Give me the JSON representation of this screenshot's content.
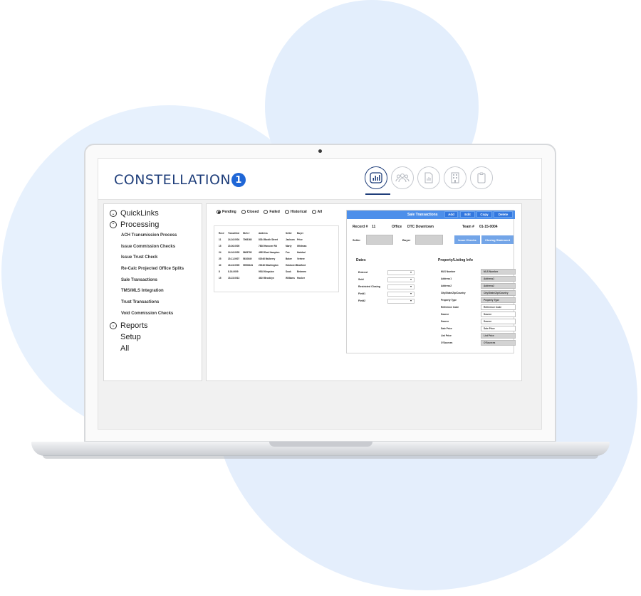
{
  "app": {
    "logo_text": "CONSTELLATION",
    "logo_badge": "1",
    "nav_icons": [
      "bar-chart-icon",
      "users-icon",
      "document-icon",
      "building-icon",
      "clipboard-icon"
    ],
    "active_nav": "bar-chart-icon",
    "accent_color": "#1f3e7a",
    "brand_blue": "#4d8fea"
  },
  "sidebar": {
    "sections": [
      {
        "label": "QuickLinks",
        "chevron": "down",
        "items": []
      },
      {
        "label": "Processing",
        "chevron": "up",
        "items": [
          "ACH Transmission Process",
          "Issue Commission Checks",
          "Issue Trust Check",
          "Re-Calc Projected Office Splits",
          "Sale Transactions",
          "TMS/MLS Integration",
          "Trust Transactions",
          "Void Commission Checks"
        ]
      },
      {
        "label": "Reports",
        "chevron": "down",
        "items": []
      },
      {
        "label": "Setup",
        "chevron": "",
        "items": []
      },
      {
        "label": "All",
        "chevron": "",
        "items": []
      }
    ]
  },
  "filters": {
    "options": [
      "Pending",
      "Closed",
      "Failed",
      "Historical",
      "All"
    ],
    "selected": "Pending"
  },
  "list": {
    "headers": [
      "Rec#",
      "Trans#/Ind",
      "MLS #",
      "Address",
      "Seller",
      "Buyer"
    ],
    "rows": [
      [
        "11",
        "24-16-0004",
        "7068168",
        "8334 Booth Street",
        "Jackson",
        "Price"
      ],
      [
        "15",
        "20-06-0005",
        "",
        "7808 Hanover Rd",
        "Marty",
        "Whitman"
      ],
      [
        "24",
        "24-16-0005",
        "5665795",
        "4955 East Hampton",
        "Fox",
        "Haddad"
      ],
      [
        "25",
        "20-11-0007",
        "5610649",
        "61946 Mulberry",
        "Baker",
        "Vertere"
      ],
      [
        "40",
        "40-23-0005",
        "99908181",
        "29246 Washington",
        "Holdover/Bradford",
        ""
      ],
      [
        "8",
        "8-16-0009",
        "",
        "9918 Kingston",
        "Sook",
        "Between"
      ],
      [
        "15",
        "15-15-0013",
        "",
        "4619 Brooklyn",
        "Williams",
        "Hooker"
      ]
    ]
  },
  "detail": {
    "title": "Sale Transactions",
    "buttons": [
      "Add",
      "Edit",
      "Copy",
      "Delete"
    ],
    "record_label": "Record #",
    "record_value": "11",
    "office_label": "Office",
    "office_value": "DTC Downtown",
    "team_label": "Team #",
    "team_value": "01-15-0004",
    "seller_label": "Seller",
    "buyer_label": "Buyer",
    "issue_checks": "Issue Checks",
    "closing_statement": "Closing Statement",
    "dates_title": "Dates",
    "dates": [
      "Entered",
      "Sold",
      "Restricted Closing",
      "Field1",
      "Field2"
    ],
    "property_title": "Property/Listing Info",
    "property_fields": [
      {
        "label": "MLS Number",
        "value": "MLS Number",
        "style": "gray"
      },
      {
        "label": "Address1",
        "value": "Address1",
        "style": "gray"
      },
      {
        "label": "Address2",
        "value": "Address2",
        "style": "gray"
      },
      {
        "label": "City/State/Zip/Country",
        "value": "City/State/Zip/Country",
        "style": "gray"
      },
      {
        "label": "Property Type",
        "value": "Property Type",
        "style": "gray"
      },
      {
        "label": "Reference Code",
        "value": "Reference Code",
        "style": "white"
      },
      {
        "label": "Source",
        "value": "Source",
        "style": "white"
      },
      {
        "label": "Source",
        "value": "Source",
        "style": "white"
      },
      {
        "label": "Sale Price",
        "value": "Sale Price",
        "style": "white"
      },
      {
        "label": "List Price",
        "value": "List Price",
        "style": "gray"
      },
      {
        "label": "O'Sources",
        "value": "O'Sources",
        "style": "gray"
      }
    ]
  }
}
